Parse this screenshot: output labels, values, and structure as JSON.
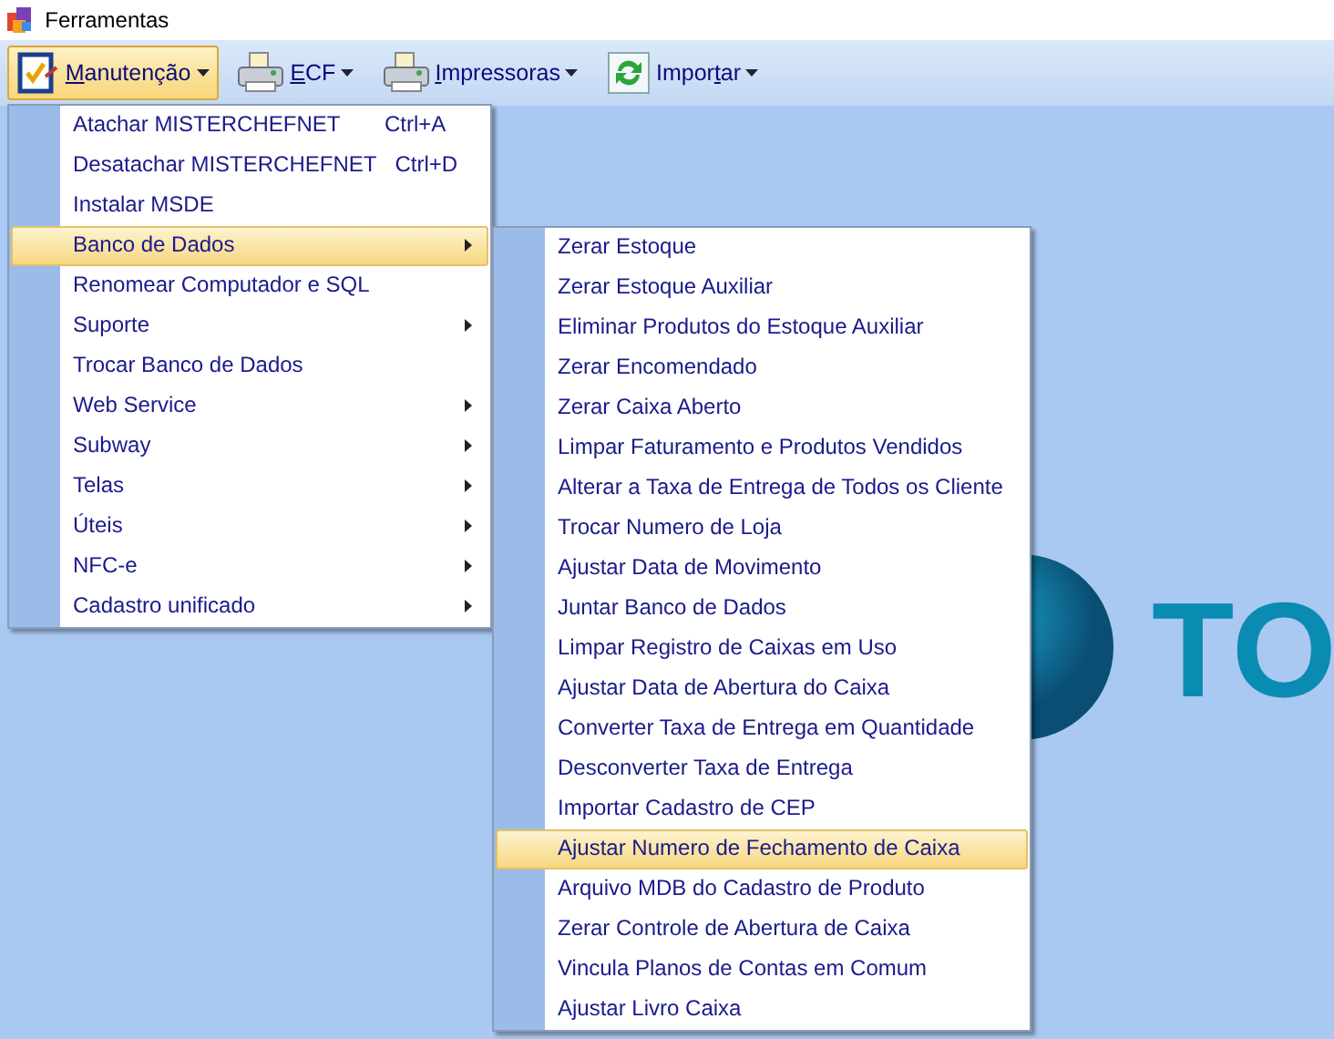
{
  "window": {
    "title": "Ferramentas"
  },
  "toolbar": [
    {
      "accel": "M",
      "label_after": "anutenção",
      "selected": true
    },
    {
      "accel": "E",
      "label_after": "CF",
      "selected": false
    },
    {
      "accel": "I",
      "label_after": "mpressoras",
      "selected": false
    },
    {
      "label_before": "Impor",
      "accel": "t",
      "label_after": "ar",
      "selected": false
    }
  ],
  "menu": [
    {
      "label": "Atachar MISTERCHEFNET",
      "shortcut": "Ctrl+A",
      "submenu": false,
      "selected": false
    },
    {
      "label": "Desatachar MISTERCHEFNET",
      "shortcut": "Ctrl+D",
      "submenu": false,
      "selected": false
    },
    {
      "label": "Instalar MSDE",
      "submenu": false,
      "selected": false
    },
    {
      "label": "Banco de Dados",
      "submenu": true,
      "selected": true
    },
    {
      "label": "Renomear Computador e SQL",
      "submenu": false,
      "selected": false
    },
    {
      "label": "Suporte",
      "submenu": true,
      "selected": false
    },
    {
      "label": "Trocar Banco de Dados",
      "submenu": false,
      "selected": false
    },
    {
      "label": "Web Service",
      "submenu": true,
      "selected": false
    },
    {
      "label": "Subway",
      "submenu": true,
      "selected": false
    },
    {
      "label": "Telas",
      "submenu": true,
      "selected": false
    },
    {
      "label": "Úteis",
      "submenu": true,
      "selected": false
    },
    {
      "label": "NFC-e",
      "submenu": true,
      "selected": false
    },
    {
      "label": "Cadastro unificado",
      "submenu": true,
      "selected": false
    }
  ],
  "submenu": [
    {
      "label": "Zerar Estoque",
      "selected": false
    },
    {
      "label": "Zerar Estoque Auxiliar",
      "selected": false
    },
    {
      "label": "Eliminar Produtos do Estoque Auxiliar",
      "selected": false
    },
    {
      "label": "Zerar Encomendado",
      "selected": false
    },
    {
      "label": "Zerar Caixa Aberto",
      "selected": false
    },
    {
      "label": "Limpar Faturamento e Produtos Vendidos",
      "selected": false
    },
    {
      "label": "Alterar a Taxa de Entrega de Todos os Cliente",
      "selected": false
    },
    {
      "label": "Trocar Numero de Loja",
      "selected": false
    },
    {
      "label": "Ajustar Data de Movimento",
      "selected": false
    },
    {
      "label": "Juntar Banco de Dados",
      "selected": false
    },
    {
      "label": "Limpar Registro de Caixas em Uso",
      "selected": false
    },
    {
      "label": "Ajustar Data de Abertura do Caixa",
      "selected": false
    },
    {
      "label": "Converter Taxa de Entrega em Quantidade",
      "selected": false
    },
    {
      "label": "Desconverter Taxa de Entrega",
      "selected": false
    },
    {
      "label": "Importar Cadastro de CEP",
      "selected": false
    },
    {
      "label": "Ajustar Numero de Fechamento de Caixa",
      "selected": true
    },
    {
      "label": "Arquivo MDB do Cadastro de Produto",
      "selected": false
    },
    {
      "label": "Zerar Controle de Abertura de Caixa",
      "selected": false
    },
    {
      "label": "Vincula Planos de Contas em Comum",
      "selected": false
    },
    {
      "label": "Ajustar Livro Caixa",
      "selected": false
    }
  ],
  "logo": {
    "text": "TO"
  }
}
